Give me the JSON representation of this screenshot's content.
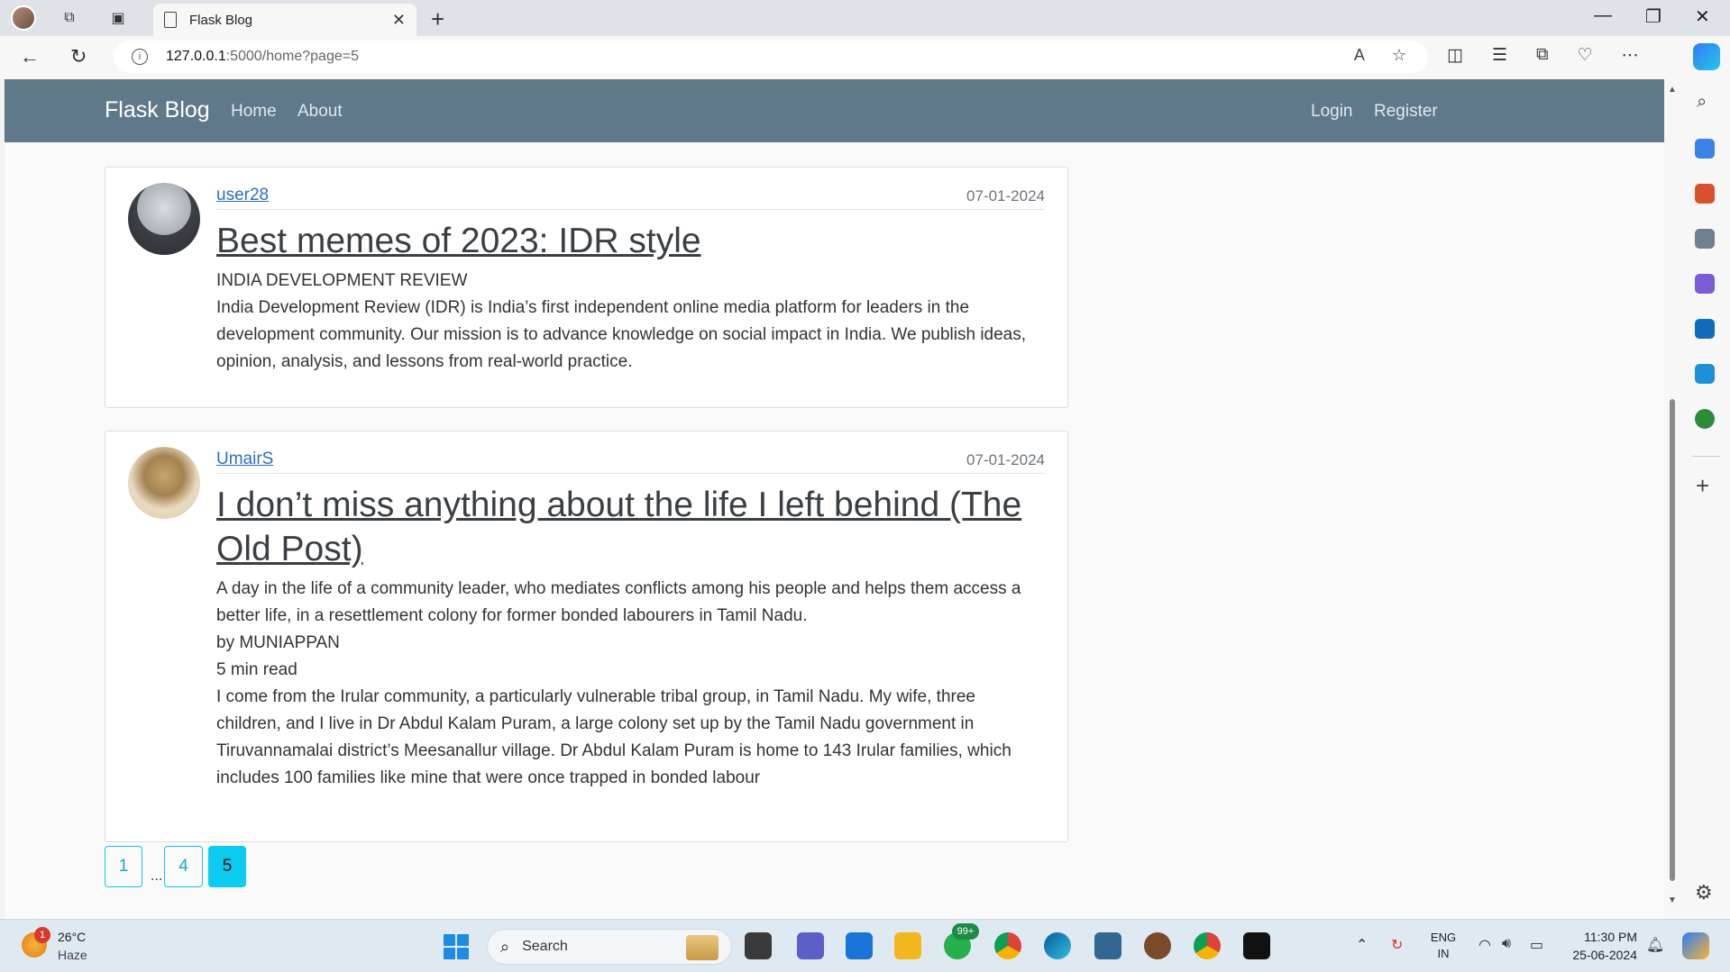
{
  "browser": {
    "tab_title": "Flask Blog",
    "url_host": "127.0.0.1",
    "url_rest": ":5000/home?page=5"
  },
  "site": {
    "brand": "Flask Blog",
    "nav_left": [
      "Home",
      "About"
    ],
    "nav_right": [
      "Login",
      "Register"
    ]
  },
  "posts": [
    {
      "author": "user28",
      "date": "07-01-2024",
      "title": "Best memes of 2023: IDR style",
      "body": "INDIA DEVELOPMENT REVIEW\nIndia Development Review (IDR) is India’s first independent online media platform for leaders in the development community. Our mission is to advance knowledge on social impact in India. We publish ideas, opinion, analysis, and lessons from real-world practice."
    },
    {
      "author": "UmairS",
      "date": "07-01-2024",
      "title": "I don’t miss anything about the life I left behind (The Old Post)",
      "body": "A day in the life of a community leader, who mediates conflicts among his people and helps them access a better life, in a resettlement colony for former bonded labourers in Tamil Nadu.\nby MUNIAPPAN\n5 min read\nI come from the Irular community, a particularly vulnerable tribal group, in Tamil Nadu. My wife, three children, and I live in Dr Abdul Kalam Puram, a large colony set up by the Tamil Nadu government in Tiruvannamalai district’s Meesanallur village. Dr Abdul Kalam Puram is home to 143 Irular families, which includes 100 families like mine that were once trapped in bonded labour"
    }
  ],
  "pagination": {
    "pages": [
      "1",
      "4",
      "5"
    ],
    "ellipsis": "...",
    "active": "5"
  },
  "taskbar": {
    "weather_badge": "1",
    "temperature": "26°C",
    "weather": "Haze",
    "search_label": "Search",
    "whatsapp_badge": "99+",
    "lang_top": "ENG",
    "lang_bottom": "IN",
    "time": "11:30 PM",
    "date": "25-06-2024"
  },
  "colors": {
    "site_nav": "#5f788a",
    "link": "#2a6fc9",
    "pager_active": "#0dcaf0"
  }
}
